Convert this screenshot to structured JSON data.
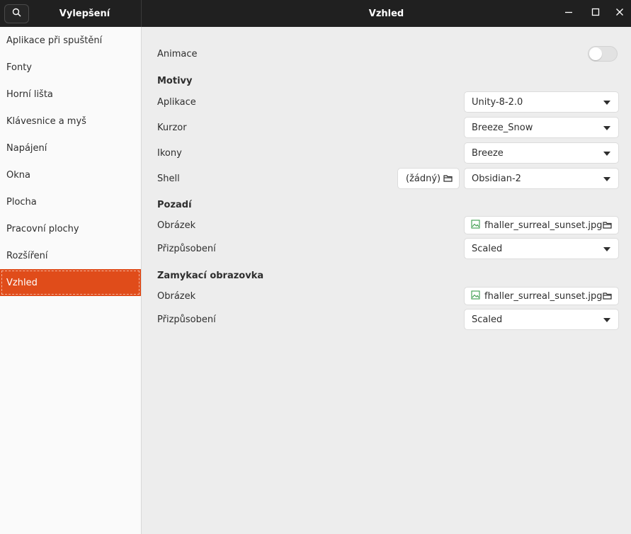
{
  "header": {
    "sidebar_title": "Vylepšení",
    "main_title": "Vzhled"
  },
  "sidebar": {
    "items": [
      {
        "label": "Aplikace při spuštění"
      },
      {
        "label": "Fonty"
      },
      {
        "label": "Horní lišta"
      },
      {
        "label": "Klávesnice a myš"
      },
      {
        "label": "Napájení"
      },
      {
        "label": "Okna"
      },
      {
        "label": "Plocha"
      },
      {
        "label": "Pracovní plochy"
      },
      {
        "label": "Rozšíření"
      },
      {
        "label": "Vzhled",
        "active": true
      }
    ]
  },
  "main": {
    "animations": {
      "label": "Animace",
      "enabled": false
    },
    "themes": {
      "title": "Motivy",
      "applications": {
        "label": "Aplikace",
        "value": "Unity-8-2.0"
      },
      "cursor": {
        "label": "Kurzor",
        "value": "Breeze_Snow"
      },
      "icons": {
        "label": "Ikony",
        "value": "Breeze"
      },
      "shell": {
        "label": "Shell",
        "file_value": "(žádný)",
        "value": "Obsidian-2"
      }
    },
    "background": {
      "title": "Pozadí",
      "image": {
        "label": "Obrázek",
        "value": "fhaller_surreal_sunset.jpg"
      },
      "adjustment": {
        "label": "Přizpůsobení",
        "value": "Scaled"
      }
    },
    "lock_screen": {
      "title": "Zamykací obrazovka",
      "image": {
        "label": "Obrázek",
        "value": "fhaller_surreal_sunset.jpg"
      },
      "adjustment": {
        "label": "Přizpůsobení",
        "value": "Scaled"
      }
    }
  },
  "colors": {
    "accent": "#e04c1a",
    "header_bg": "#202020",
    "sidebar_bg": "#fafafa",
    "main_bg": "#ededed"
  }
}
